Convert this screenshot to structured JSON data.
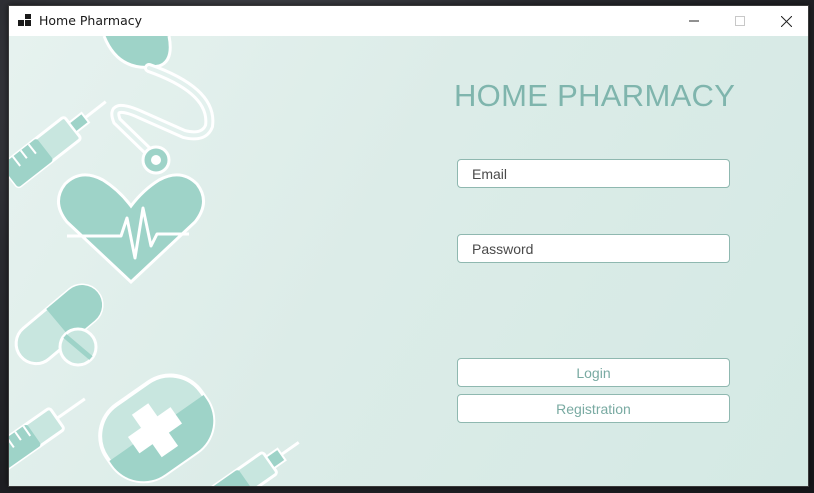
{
  "window": {
    "title": "Home Pharmacy",
    "icon": "app-icon",
    "controls": [
      "minimize-icon",
      "maximize-icon",
      "close-icon"
    ]
  },
  "login": {
    "heading": "HOME PHARMACY",
    "email_placeholder": "Email",
    "password_placeholder": "Password",
    "login_label": "Login",
    "registration_label": "Registration"
  },
  "decorations": [
    "stethoscope-icon",
    "syringe-icon",
    "heart-pulse-icon",
    "capsule-icon",
    "pill-icon",
    "blood-bag-icon"
  ],
  "colors": {
    "accent": "#7fb5ad",
    "decor": "#9ed3c8",
    "background": "#dcece8",
    "border": "#8fb8b0"
  }
}
